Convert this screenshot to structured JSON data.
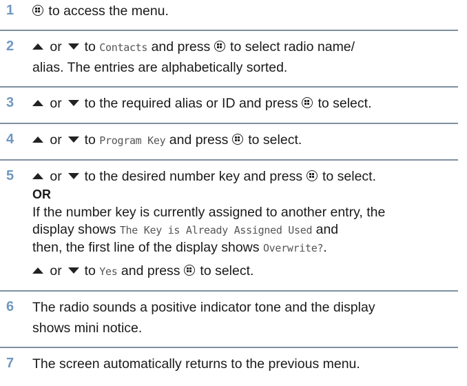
{
  "steps": [
    {
      "number": "1",
      "lines": [
        [
          "",
          " to access the menu."
        ]
      ]
    },
    {
      "number": "2",
      "line1_a": " or ",
      "line1_b": " to ",
      "contacts": "Contacts",
      "line1_c": " and press ",
      "line1_d": " to select radio name/",
      "line2": "alias. The entries are alphabetically sorted."
    },
    {
      "number": "3",
      "a": " or ",
      "b": " to the required alias or ID and press ",
      "c": " to select."
    },
    {
      "number": "4",
      "a": " or ",
      "b": " to ",
      "program_key": "Program Key",
      "c": " and press ",
      "d": " to select."
    },
    {
      "number": "5",
      "a": " or ",
      "b": " to the desired number key and press ",
      "c": " to select.",
      "or_label": "OR",
      "para1": "If the number key is currently assigned to another entry, the",
      "para2_a": "display shows ",
      "already_assigned": "The Key is Already Assigned Used",
      "para2_b": " and",
      "para3_a": "then, the first line of the display shows ",
      "overwrite": "Overwrite?",
      "para3_b": ".",
      "last_a": " or ",
      "last_b": " to ",
      "yes": "Yes",
      "last_c": " and press ",
      "last_d": " to select."
    },
    {
      "number": "6",
      "line1": "The radio sounds a positive indicator tone and the display",
      "line2": "shows mini notice."
    },
    {
      "number": "7",
      "line1": "The screen automatically returns to the previous menu."
    }
  ],
  "step1_text": " to access the menu.",
  "colors": {
    "step_number": "#6f97c0",
    "separator": "#7e8f9f",
    "text": "#1a1a1a"
  },
  "icons": {
    "menu": "menu-ok-button-icon",
    "up": "up-arrow-icon",
    "down": "down-arrow-icon"
  }
}
